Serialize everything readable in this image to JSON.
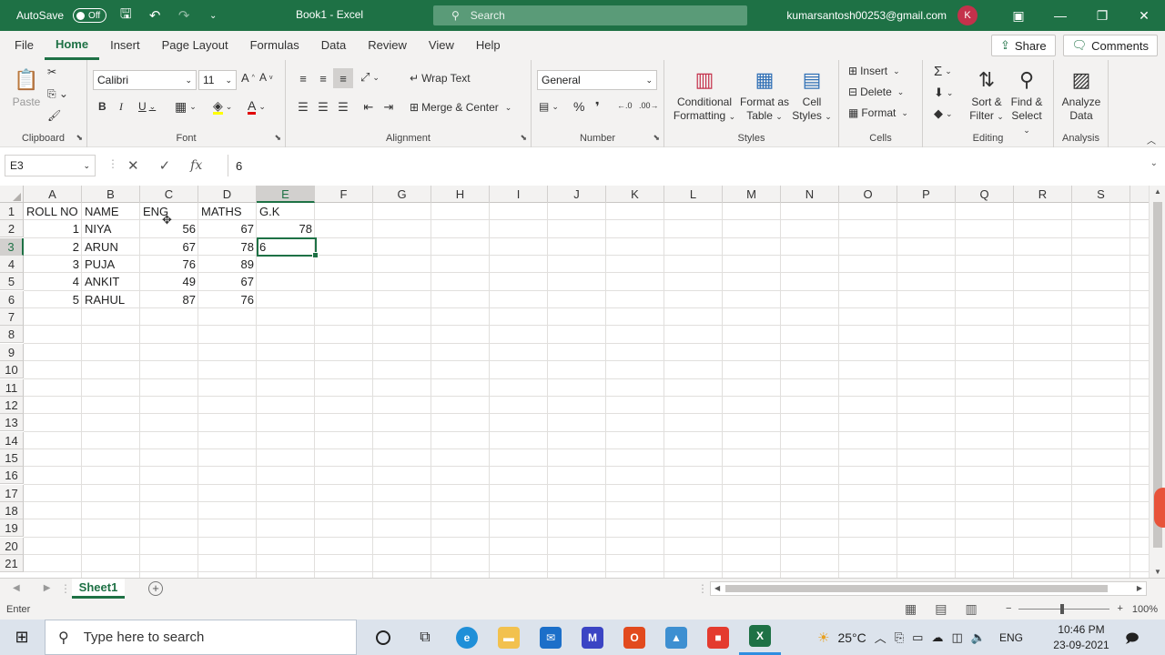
{
  "titlebar": {
    "autosave_label": "AutoSave",
    "autosave_state": "Off",
    "title": "Book1  -  Excel",
    "search_placeholder": "Search",
    "account": "kumarsantosh00253@gmail.com",
    "avatar_initial": "K"
  },
  "ribbon_tabs": [
    "File",
    "Home",
    "Insert",
    "Page Layout",
    "Formulas",
    "Data",
    "Review",
    "View",
    "Help"
  ],
  "active_tab": "Home",
  "share_label": "Share",
  "comments_label": "Comments",
  "ribbon": {
    "clipboard": {
      "paste": "Paste",
      "label": "Clipboard"
    },
    "font": {
      "name": "Calibri",
      "size": "11",
      "label": "Font"
    },
    "alignment": {
      "wrap": "Wrap Text",
      "merge": "Merge & Center",
      "label": "Alignment"
    },
    "number": {
      "format": "General",
      "label": "Number"
    },
    "styles": {
      "conditional": [
        "Conditional",
        "Formatting"
      ],
      "format_table": [
        "Format as",
        "Table"
      ],
      "cell_styles": [
        "Cell",
        "Styles"
      ],
      "label": "Styles"
    },
    "cells": {
      "insert": "Insert",
      "delete": "Delete",
      "format": "Format",
      "label": "Cells"
    },
    "editing": {
      "sort": [
        "Sort &",
        "Filter"
      ],
      "find": [
        "Find &",
        "Select"
      ],
      "label": "Editing"
    },
    "analysis": {
      "analyze": [
        "Analyze",
        "Data"
      ],
      "label": "Analysis"
    }
  },
  "formula_bar": {
    "name_box": "E3",
    "value": "6"
  },
  "columns": [
    "A",
    "B",
    "C",
    "D",
    "E",
    "F",
    "G",
    "H",
    "I",
    "J",
    "K",
    "L",
    "M",
    "N",
    "O",
    "P",
    "Q",
    "R",
    "S"
  ],
  "rows": [
    "1",
    "2",
    "3",
    "4",
    "5",
    "6",
    "7",
    "8",
    "9",
    "10",
    "11",
    "12",
    "13",
    "14",
    "15",
    "16",
    "17",
    "18",
    "19",
    "20",
    "21"
  ],
  "selected_column": "E",
  "selected_row": "3",
  "cells": {
    "header": [
      "ROLL NO",
      "NAME",
      "ENG",
      "MATHS",
      "G.K"
    ],
    "data": [
      [
        "1",
        "NIYA",
        "56",
        "67",
        "78"
      ],
      [
        "2",
        "ARUN",
        "67",
        "78",
        "6"
      ],
      [
        "3",
        "PUJA",
        "76",
        "89",
        ""
      ],
      [
        "4",
        "ANKIT",
        "49",
        "67",
        ""
      ],
      [
        "5",
        "RAHUL",
        "87",
        "76",
        ""
      ]
    ]
  },
  "sheet_tab": "Sheet1",
  "status": {
    "mode": "Enter",
    "zoom": "100%"
  },
  "taskbar": {
    "search_placeholder": "Type here to search",
    "temperature": "25°C",
    "language": "ENG",
    "time": "10:46 PM",
    "date": "23-09-2021"
  },
  "colors": {
    "excel_green": "#1e7145",
    "ribbon_bg": "#f3f2f1"
  }
}
